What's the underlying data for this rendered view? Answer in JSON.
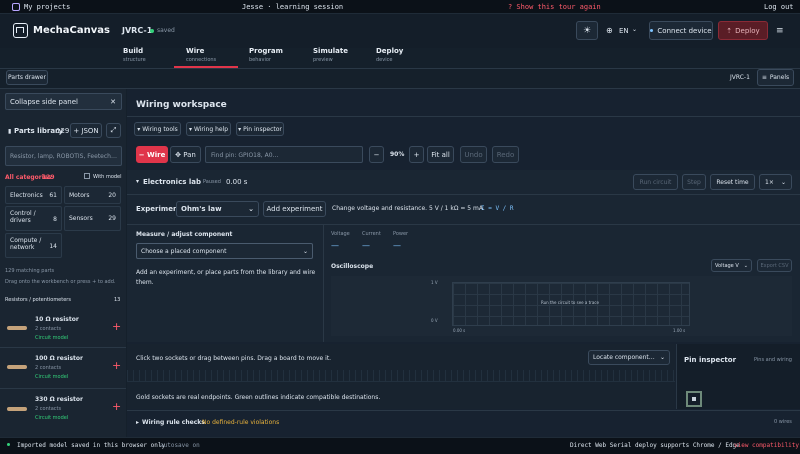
{
  "system_bar": {
    "left": "My projects",
    "center": "Jesse · learning session",
    "alert": "? Show this tour again",
    "right": "Log out"
  },
  "header": {
    "brand": "MechaCanvas",
    "project": "JVRC-1",
    "status": "saved",
    "language": "EN",
    "connect_label": "Connect device",
    "deploy_label": "Deploy",
    "tabs": [
      {
        "label": "Build",
        "sub": "structure"
      },
      {
        "label": "Wire",
        "sub": "connections"
      },
      {
        "label": "Program",
        "sub": "behavior"
      },
      {
        "label": "Simulate",
        "sub": "preview"
      },
      {
        "label": "Deploy",
        "sub": "device"
      }
    ]
  },
  "subbar": {
    "parts_drawer": "Parts drawer",
    "model": "JVRC-1",
    "panels": "Panels"
  },
  "sidebar": {
    "collapse_label": "Collapse side panel",
    "library_title": "Parts library",
    "library_count": "129",
    "json_label": "+ JSON",
    "search_placeholder": "Resistor, lamp, ROBOTIS, Feetech…",
    "all_categories": "All categories",
    "all_count": "129",
    "with_model": "With model",
    "categories": [
      {
        "label": "Electronics",
        "count": "61"
      },
      {
        "label": "Motors",
        "count": "20"
      },
      {
        "label": "Control / drivers",
        "count": "8"
      },
      {
        "label": "Sensors",
        "count": "29"
      },
      {
        "label": "Compute / network",
        "count": "14"
      }
    ],
    "matching": "129 matching parts",
    "drag_hint": "Drag onto the workbench or press + to add.",
    "group_label": "Resistors / potentiometers",
    "group_count": "13",
    "parts": [
      {
        "name": "10 Ω resistor",
        "contacts": "2 contacts",
        "badge": "Circuit model"
      },
      {
        "name": "100 Ω resistor",
        "contacts": "2 contacts",
        "badge": "Circuit model"
      },
      {
        "name": "330 Ω resistor",
        "contacts": "2 contacts",
        "badge": "Circuit model"
      }
    ]
  },
  "workspace": {
    "title": "Wiring workspace",
    "tools": [
      "Wiring tools",
      "Wiring help",
      "Pin inspector"
    ],
    "wire_btn": "− Wire",
    "pan_btn": "✥ Pan",
    "find_placeholder": "Find pin: GPIO18, A0…",
    "zoom": "90%",
    "zoom_minus": "−",
    "zoom_plus": "+",
    "fit": "Fit all",
    "undo": "Undo",
    "redo": "Redo"
  },
  "lab": {
    "title": "Electronics lab",
    "paused": "Paused",
    "time": "0.00 s",
    "run": "Run circuit",
    "step": "Step",
    "reset": "Reset time",
    "speed": "1×",
    "experiments_label": "Experiments",
    "experiment": "Ohm's law",
    "add_experiment": "Add experiment",
    "description": "Change voltage and resistance. 5 V / 1 kΩ = 5 mA.",
    "formula": "I = V / R",
    "measure_title": "Measure / adjust component",
    "component_placeholder": "Choose a placed component",
    "hint": "Add an experiment, or place parts from the library and wire them.",
    "readouts": [
      {
        "label": "Voltage",
        "value": "—"
      },
      {
        "label": "Current",
        "value": "—"
      },
      {
        "label": "Power",
        "value": "—"
      }
    ],
    "osc_title": "Oscilloscope",
    "osc_select": "Voltage V",
    "export": "Export CSV",
    "y_top": "1 V",
    "y_bottom": "0 V",
    "x_left": "0.00 s",
    "x_right": "1.00 s",
    "run_hint": "Run the circuit to see a trace"
  },
  "canvas": {
    "hint": "Click two sockets or drag between pins. Drag a board to move it.",
    "locate": "Locate component…",
    "sockets_note": "Gold sockets are real endpoints. Green outlines indicate compatible destinations."
  },
  "inspector": {
    "title": "Pin inspector",
    "sub": "Pins and wiring"
  },
  "rules": {
    "label": "Wiring rule checks",
    "status": "No defined-rule violations",
    "count": "0 wires"
  },
  "footer": {
    "left": "Imported model saved in this browser only",
    "autosave": "autosave on",
    "right": "Direct Web Serial deploy supports Chrome / Edge",
    "link": "view compatibility"
  },
  "colors": {
    "accent": "#e0354a",
    "saved": "#33d17a",
    "background": "#15202b"
  }
}
